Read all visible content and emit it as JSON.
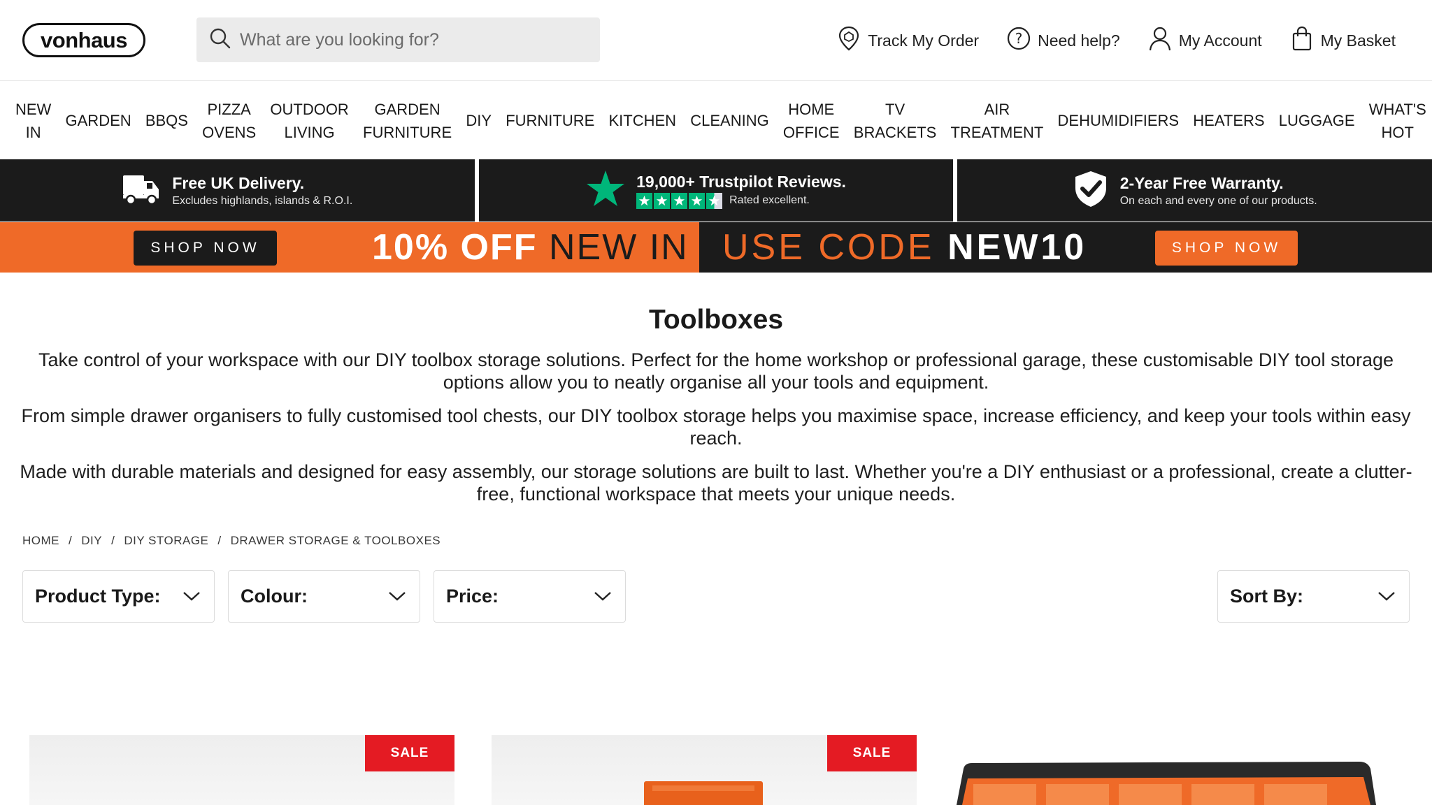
{
  "header": {
    "logo": "vonhaus",
    "search_placeholder": "What are you looking for?",
    "links": {
      "track": "Track My Order",
      "help": "Need help?",
      "account": "My Account",
      "basket": "My Basket"
    }
  },
  "nav": {
    "items": [
      "NEW\nIN",
      "GARDEN",
      "BBQS",
      "PIZZA\nOVENS",
      "OUTDOOR\nLIVING",
      "GARDEN\nFURNITURE",
      "DIY",
      "FURNITURE",
      "KITCHEN",
      "CLEANING",
      "HOME\nOFFICE",
      "TV\nBRACKETS",
      "AIR\nTREATMENT",
      "DEHUMIDIFIERS",
      "HEATERS",
      "LUGGAGE",
      "WHAT'S\nHOT"
    ]
  },
  "usp": {
    "delivery": {
      "title": "Free UK Delivery.",
      "sub": "Excludes highlands, islands & R.O.I."
    },
    "trustpilot": {
      "title": "19,000+ Trustpilot Reviews.",
      "sub": "Rated excellent.",
      "stars": 4.5
    },
    "warranty": {
      "title": "2-Year Free Warranty.",
      "sub": "On each and every one of our products."
    }
  },
  "promo": {
    "shop_now_left": "SHOP NOW",
    "offer_bold": "10% OFF",
    "offer_light": "NEW IN",
    "code_light": "USE CODE",
    "code_bold": "NEW10",
    "shop_now_right": "SHOP NOW",
    "colors": {
      "orange": "#ef6a28",
      "dark": "#1b1b1b"
    }
  },
  "page": {
    "title": "Toolboxes",
    "intro": [
      "Take control of your workspace with our DIY toolbox storage solutions. Perfect for the home workshop or professional garage, these customisable DIY tool storage options allow you to neatly organise all your tools and equipment.",
      "From simple drawer organisers to fully customised tool chests, our DIY toolbox storage helps you maximise space, increase efficiency, and keep your tools within easy reach.",
      "Made with durable materials and designed for easy assembly, our storage solutions are built to last. Whether you're a DIY enthusiast or a professional, create a clutter-free, functional workspace that meets your unique needs."
    ]
  },
  "breadcrumb": [
    "HOME",
    "DIY",
    "DIY STORAGE",
    "DRAWER STORAGE & TOOLBOXES"
  ],
  "filters": {
    "product_type": "Product Type:",
    "colour": "Colour:",
    "price": "Price:",
    "sort": "Sort By:"
  },
  "products": {
    "sale_badge": "SALE",
    "sale_color": "#e41b23"
  }
}
